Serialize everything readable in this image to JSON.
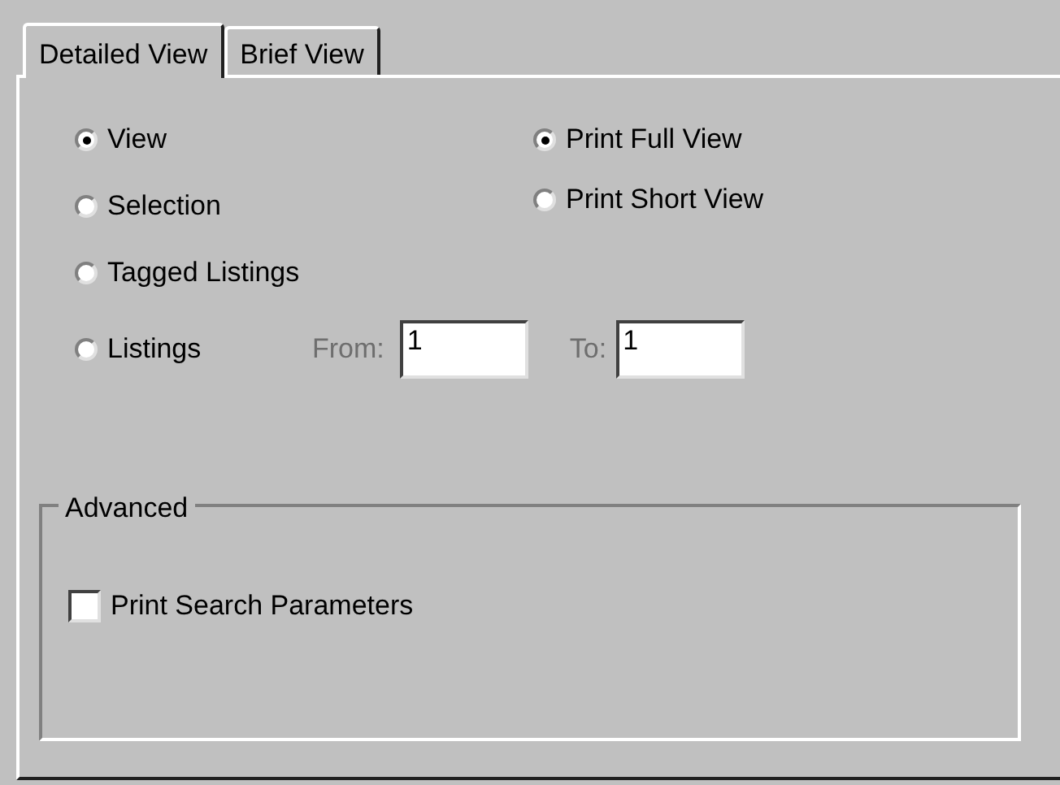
{
  "tabs": [
    {
      "label": "Detailed View",
      "selected": true
    },
    {
      "label": "Brief View",
      "selected": false
    }
  ],
  "scope_options": [
    {
      "label": "View",
      "selected": true
    },
    {
      "label": "Selection",
      "selected": false
    },
    {
      "label": "Tagged Listings",
      "selected": false
    },
    {
      "label": "Listings",
      "selected": false
    }
  ],
  "range": {
    "from_label": "From:",
    "from_value": "1",
    "to_label": "To:",
    "to_value": "1",
    "disabled": true
  },
  "print_options": [
    {
      "label": "Print Full View",
      "selected": true
    },
    {
      "label": "Print Short View",
      "selected": false
    }
  ],
  "advanced": {
    "title": "Advanced",
    "checkbox": {
      "label": "Print Search Parameters",
      "checked": false
    }
  }
}
